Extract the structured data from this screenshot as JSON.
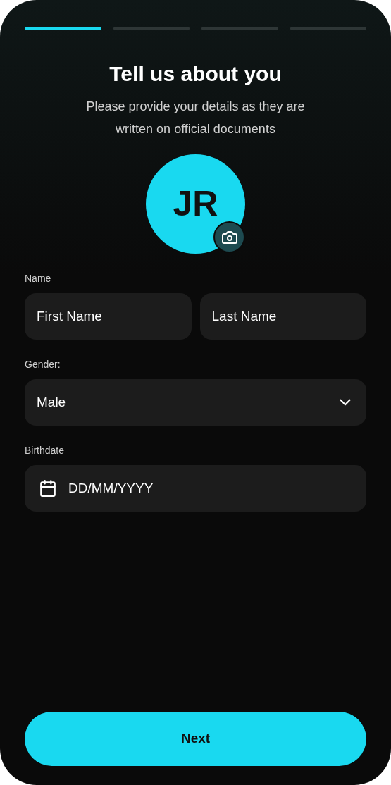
{
  "progress": [
    {
      "selected": true
    },
    {
      "selected": false
    },
    {
      "selected": false
    },
    {
      "selected": false
    }
  ],
  "title": "Tell us about you",
  "subtitle": "Please provide your details as they are written on official documents",
  "avatar": {
    "initials": "JR"
  },
  "name": {
    "label": "Name",
    "first_name": {
      "placeholder": "First Name"
    },
    "last_name": {
      "placeholder": "Last Name"
    }
  },
  "gender": {
    "label": "Gender:",
    "value": "Male"
  },
  "birthdate": {
    "label": "Birthdate",
    "placeholder": "DD/MM/YYYY"
  },
  "next_button": "Next"
}
